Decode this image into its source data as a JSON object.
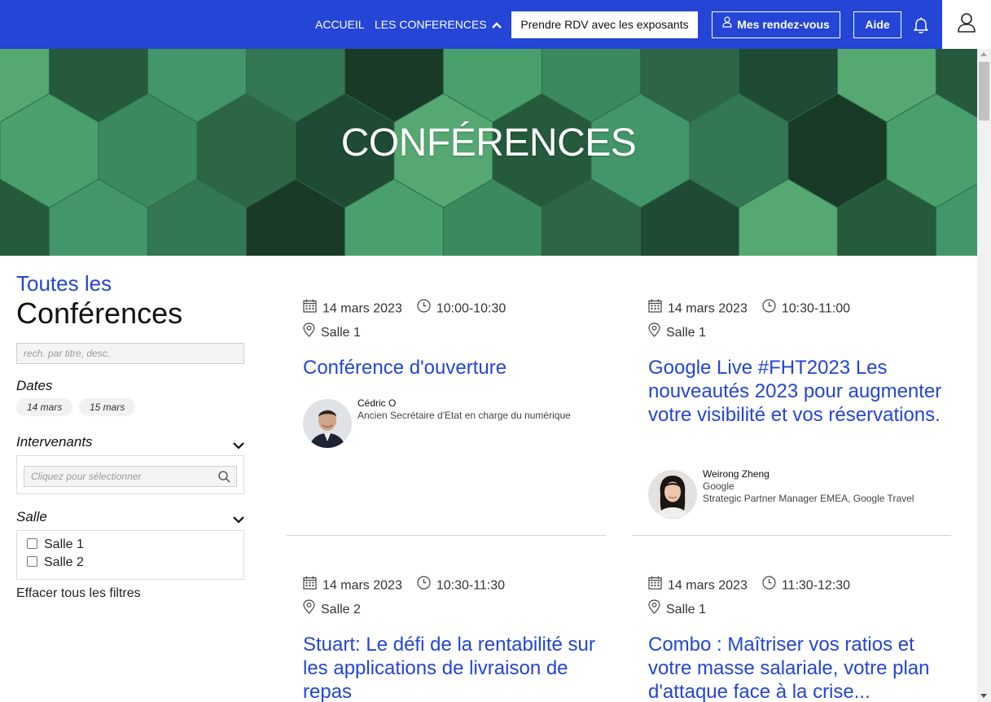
{
  "nav": {
    "home": "ACCUEIL",
    "conferences": "LES CONFERENCES",
    "rdv_button": "Prendre RDV avec les exposants",
    "my_meetings": "Mes rendez-vous",
    "help": "Aide",
    "icons": {
      "bell": "bell-icon",
      "user": "user-icon"
    }
  },
  "hero": {
    "title": "CONFÉRENCES"
  },
  "sidebar": {
    "kicker": "Toutes les",
    "title": "Conférences",
    "search_placeholder": "rech. par titre, desc.",
    "dates_label": "Dates",
    "dates": [
      "14 mars",
      "15 mars"
    ],
    "speakers_label": "Intervenants",
    "speakers_placeholder": "Cliquez pour sélectionner",
    "room_label": "Salle",
    "rooms": [
      "Salle 1",
      "Salle 2"
    ],
    "clear_filters": "Effacer tous les filtres"
  },
  "conferences": [
    {
      "date": "14 mars 2023",
      "time": "10:00-10:30",
      "room": "Salle 1",
      "title": "Conférence d'ouverture",
      "speaker": {
        "name": "Cédric O",
        "lines": [
          "Ancien Secrétaire d'Etat en charge du numérique"
        ]
      }
    },
    {
      "date": "14 mars 2023",
      "time": "10:30-11:00",
      "room": "Salle 1",
      "title": "Google Live #FHT2023 Les nouveautés 2023 pour augmenter votre visibilité et vos réservations.",
      "speaker": {
        "name": "Weirong Zheng",
        "lines": [
          "Google",
          "Strategic Partner Manager EMEA, Google Travel"
        ]
      }
    },
    {
      "date": "14 mars 2023",
      "time": "10:30-11:30",
      "room": "Salle 2",
      "title": "Stuart: Le défi de la rentabilité sur les applications de livraison de repas"
    },
    {
      "date": "14 mars 2023",
      "time": "11:30-12:30",
      "room": "Salle 1",
      "title": "Combo : Maîtriser vos ratios et votre masse salariale, votre plan d'attaque face à la crise..."
    }
  ],
  "colors": {
    "brand_blue": "#2445d6",
    "hero_green": "#2f6e4c"
  }
}
